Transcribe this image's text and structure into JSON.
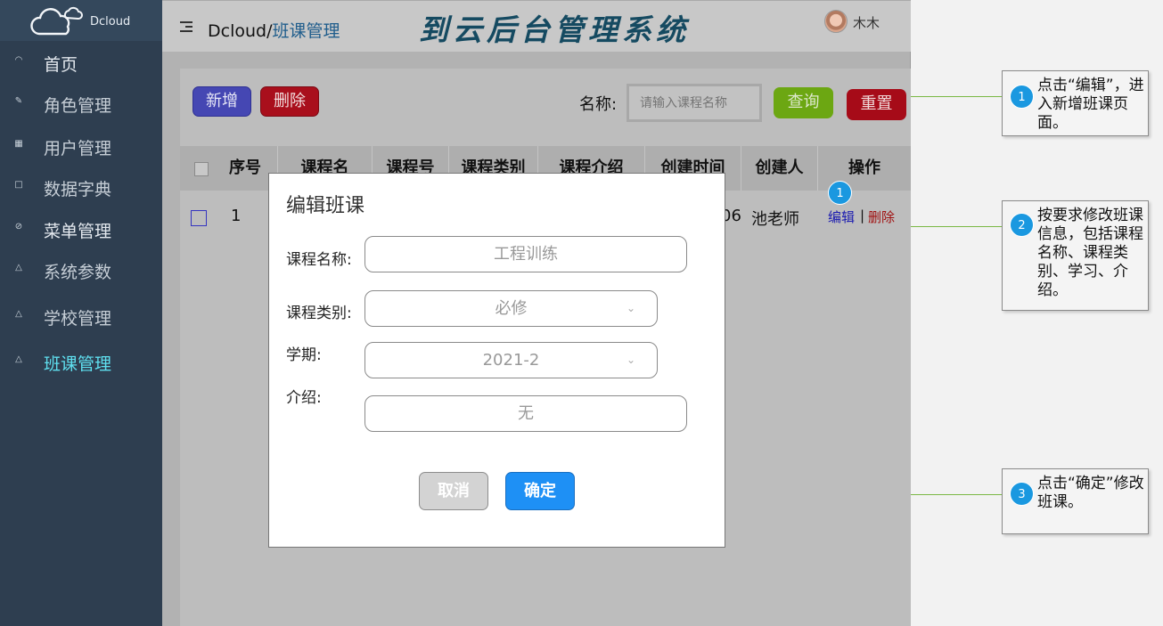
{
  "brand": {
    "name": "Dcloud",
    "logo_icon": "cloud-icon"
  },
  "sidebar": {
    "items": [
      {
        "label": "首页",
        "icon": "dashboard-icon"
      },
      {
        "label": "角色管理",
        "icon": "edit-icon"
      },
      {
        "label": "用户管理",
        "icon": "grid-icon"
      },
      {
        "label": "数据字典",
        "icon": "square-icon"
      },
      {
        "label": "菜单管理",
        "icon": "circle-icon"
      },
      {
        "label": "系统参数",
        "icon": "triangle-icon"
      },
      {
        "label": "学校管理",
        "icon": "triangle-icon"
      },
      {
        "label": "班课管理",
        "icon": "triangle-icon",
        "active": true
      }
    ]
  },
  "header": {
    "breadcrumb_root": "Dcloud/",
    "breadcrumb_current": "班课管理",
    "system_title": "到云后台管理系统",
    "user_name": "木木"
  },
  "toolbar": {
    "add_label": "新增",
    "delete_label": "删除",
    "name_label": "名称:",
    "search_placeholder": "请输入课程名称",
    "query_label": "查询",
    "reset_label": "重置"
  },
  "table": {
    "columns": [
      "序号",
      "课程名",
      "课程号",
      "课程类别",
      "课程介绍",
      "创建时间",
      "创建人",
      "操作"
    ],
    "rows": [
      {
        "index": "1",
        "created_time_partial": "06",
        "creator": "池老师",
        "edit_label": "编辑",
        "sep": "|",
        "delete_label": "删除"
      }
    ]
  },
  "modal": {
    "title": "编辑班课",
    "fields": {
      "course_name": {
        "label": "课程名称:",
        "value": "工程训练"
      },
      "course_type": {
        "label": "课程类别:",
        "value": "必修"
      },
      "semester": {
        "label": "学期:",
        "value": "2021-2"
      },
      "intro": {
        "label": "介绍:",
        "value": "无"
      }
    },
    "cancel_label": "取消",
    "ok_label": "确定"
  },
  "annotations": {
    "row_badge": "1",
    "callouts": [
      {
        "num": "1",
        "text": "点击“编辑”，进入新增班课页面。"
      },
      {
        "num": "2",
        "text": "按要求修改班课信息，包括课程名称、课程类别、学习、介绍。"
      },
      {
        "num": "3",
        "text": "点击“确定”修改班课。"
      }
    ]
  },
  "colors": {
    "sidebar_bg": "#2e3e50",
    "active_menu": "#5fe0f0",
    "primary": "#1e90f5",
    "badge": "#1a98e0",
    "callout_line": "#7ab845"
  }
}
